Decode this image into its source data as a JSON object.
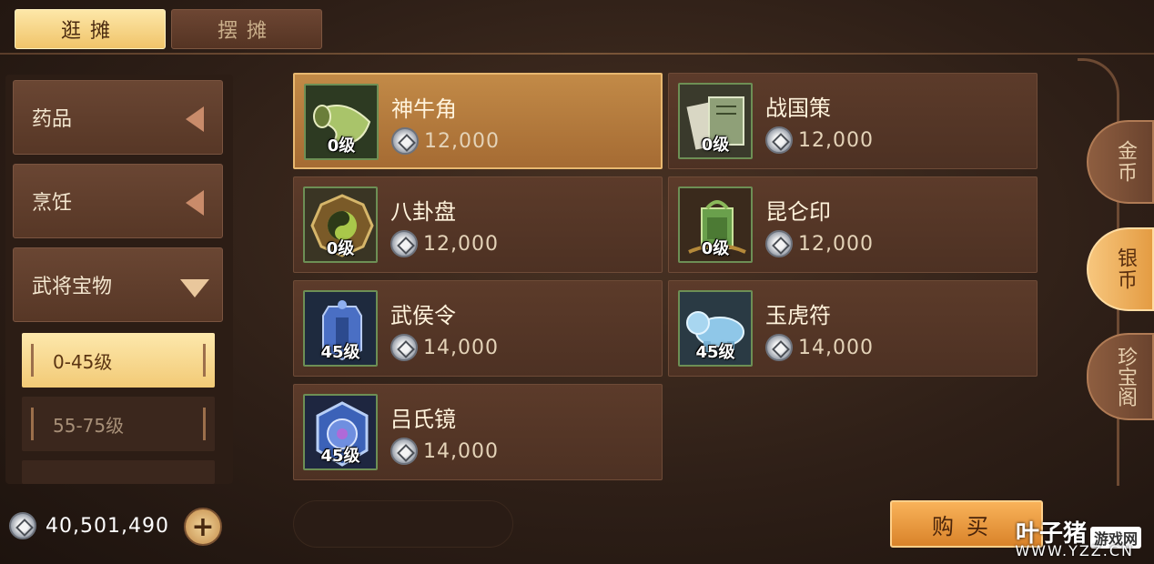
{
  "top_tabs": [
    {
      "label": "逛摊",
      "active": true
    },
    {
      "label": "摆摊",
      "active": false
    }
  ],
  "categories": [
    {
      "label": "药品",
      "expanded": false
    },
    {
      "label": "烹饪",
      "expanded": false
    },
    {
      "label": "武将宝物",
      "expanded": true
    }
  ],
  "subcategories": [
    {
      "label": "0-45级",
      "active": true
    },
    {
      "label": "55-75级",
      "active": false
    }
  ],
  "items": [
    {
      "name": "神牛角",
      "level": "0级",
      "price": "12,000",
      "icon": "ox-horn-icon",
      "selected": true
    },
    {
      "name": "战国策",
      "level": "0级",
      "price": "12,000",
      "icon": "book-scroll-icon",
      "selected": false
    },
    {
      "name": "八卦盘",
      "level": "0级",
      "price": "12,000",
      "icon": "bagua-disc-icon",
      "selected": false
    },
    {
      "name": "昆仑印",
      "level": "0级",
      "price": "12,000",
      "icon": "jade-seal-icon",
      "selected": false
    },
    {
      "name": "武侯令",
      "level": "45级",
      "price": "14,000",
      "icon": "command-token-icon",
      "selected": false
    },
    {
      "name": "玉虎符",
      "level": "45级",
      "price": "14,000",
      "icon": "jade-tiger-icon",
      "selected": false
    },
    {
      "name": "吕氏镜",
      "level": "45级",
      "price": "14,000",
      "icon": "bronze-mirror-icon",
      "selected": false
    }
  ],
  "currency_tabs": [
    {
      "label": "金币",
      "active": false
    },
    {
      "label": "银币",
      "active": true
    },
    {
      "label": "珍宝阁",
      "active": false
    }
  ],
  "footer": {
    "balance": "40,501,490",
    "plus_label": "+",
    "buy_label": "购买"
  },
  "watermark": {
    "brand": "叶子猪",
    "tag": "游戏网",
    "url": "WWW.YZZ.CN"
  },
  "colors": {
    "accent_gold": "#f2ca76",
    "buy_orange": "#e49c43",
    "card_brown": "#5c3b2a",
    "icon_frame_green": "#6d8f55"
  }
}
